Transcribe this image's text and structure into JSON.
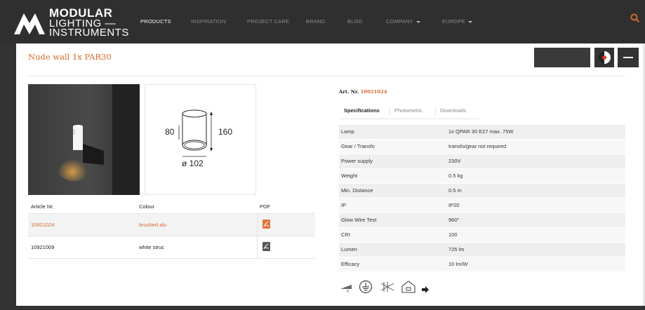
{
  "brand": {
    "line1": "MODULAR",
    "line2": "LIGHTING —",
    "line3": "INSTRUMENTS"
  },
  "nav": {
    "items": [
      {
        "label": "PRODUCTS",
        "active": true
      },
      {
        "label": "INSPIRATION",
        "active": false
      },
      {
        "label": "PROJECT CARE",
        "active": false
      },
      {
        "label": "BRAND",
        "active": false
      },
      {
        "label": "BLOG",
        "active": false
      },
      {
        "label": "COMPANY",
        "active": false,
        "dropdown": true
      },
      {
        "label": "EUROPE",
        "active": false,
        "dropdown": true
      }
    ]
  },
  "product": {
    "title": "Nude wall 1x PAR30",
    "dimensions": {
      "height_small": "80",
      "height_large": "160",
      "diameter": "ø 102"
    }
  },
  "articles": {
    "headers": [
      "Article Nr.",
      "Colour",
      "PDF"
    ],
    "rows": [
      {
        "nr": "10921024",
        "colour": "brushed alu",
        "selected": true
      },
      {
        "nr": "10921009",
        "colour": "white struc",
        "selected": false
      }
    ]
  },
  "article_info": {
    "label": "Art. Nr.",
    "number": "10921024"
  },
  "tabs": [
    "Specifications",
    "Photometric",
    "Downloads"
  ],
  "specifications": [
    {
      "key": "Lamp",
      "value": "1x QPAR 30 E27 max. 75W"
    },
    {
      "key": "Gear / Transfo",
      "value": "transfo/gear not required"
    },
    {
      "key": "Power supply",
      "value": "230V"
    },
    {
      "key": "Weight",
      "value": "0.5 kg"
    },
    {
      "key": "Min. Distance",
      "value": "0.5 m"
    },
    {
      "key": "IP",
      "value": "IP20"
    },
    {
      "key": "Glow Wire Test",
      "value": "960°"
    },
    {
      "key": "CRI",
      "value": "100"
    },
    {
      "key": "Lumen",
      "value": "725 lm"
    },
    {
      "key": "Efficacy",
      "value": "10 lm/W"
    }
  ],
  "colors": {
    "accent": "#d46a2c",
    "header_bg": "#2f2f2f"
  }
}
